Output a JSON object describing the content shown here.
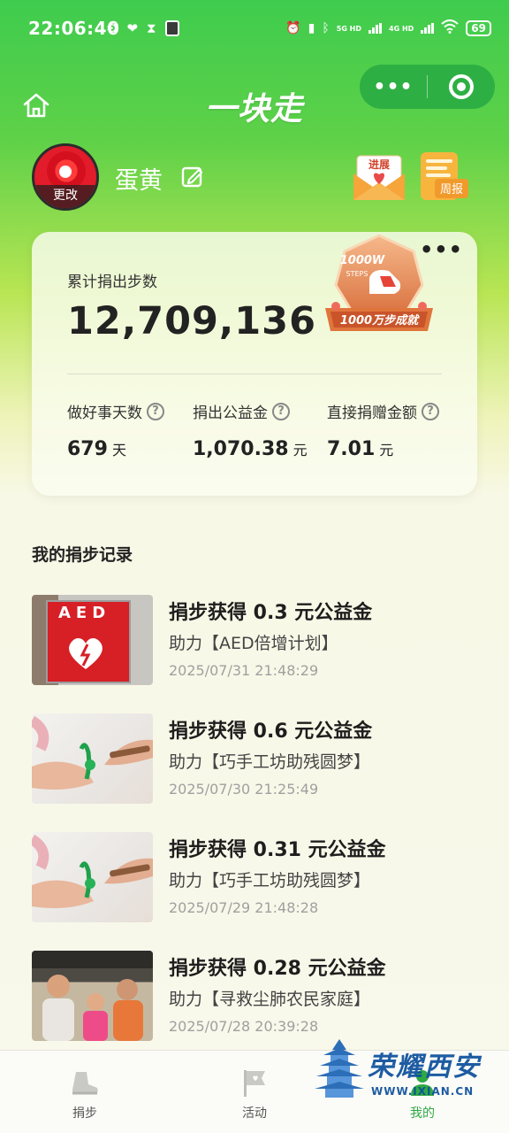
{
  "status_bar": {
    "time": "22:06:40",
    "network_1": "5G HD",
    "network_2": "4G HD",
    "battery": "69"
  },
  "header": {
    "title": "一块走",
    "capsule_more": "•••"
  },
  "profile": {
    "avatar_change_label": "更改",
    "username": "蛋黄",
    "progress_label": "进展",
    "weekly_label": "周报"
  },
  "stats": {
    "more": "•••",
    "total_steps_label": "累计捐出步数",
    "total_steps": "12,709,136",
    "badge": {
      "top_text": "1000W",
      "sub_text": "STEPS",
      "ribbon_text": "1000万步成就"
    },
    "items": [
      {
        "label": "做好事天数",
        "value": "679",
        "unit": "天"
      },
      {
        "label": "捐出公益金",
        "value": "1,070.38",
        "unit": "元"
      },
      {
        "label": "直接捐赠金额",
        "value": "7.01",
        "unit": "元"
      }
    ],
    "help_glyph": "?"
  },
  "records": {
    "title": "我的捐步记录",
    "items": [
      {
        "title": "捐步获得 0.3 元公益金",
        "project": "助力【AED倍增计划】",
        "time": "2025/07/31 21:48:29",
        "thumb_text": "AED"
      },
      {
        "title": "捐步获得 0.6 元公益金",
        "project": "助力【巧手工坊助残圆梦】",
        "time": "2025/07/30 21:25:49"
      },
      {
        "title": "捐步获得 0.31 元公益金",
        "project": "助力【巧手工坊助残圆梦】",
        "time": "2025/07/29 21:48:28"
      },
      {
        "title": "捐步获得 0.28 元公益金",
        "project": "助力【寻救尘肺农民家庭】",
        "time": "2025/07/28 20:39:28"
      }
    ]
  },
  "tabbar": {
    "tabs": [
      {
        "label": "捐步",
        "icon": "shoe-icon"
      },
      {
        "label": "活动",
        "icon": "flag-icon"
      },
      {
        "label": "我的",
        "icon": "person-icon"
      }
    ]
  },
  "watermark": {
    "text": "荣耀西安",
    "url": "WWW.IXIAN.CN"
  },
  "colors": {
    "accent_green": "#2fa944",
    "header_green": "#3fcc4e",
    "capsule": "#2eaf44"
  }
}
